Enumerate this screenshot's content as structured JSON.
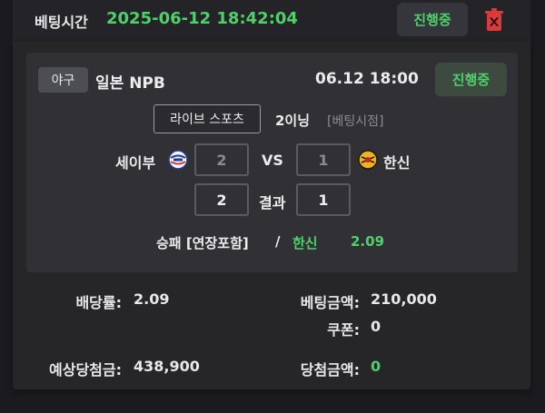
{
  "header": {
    "bet_time_label": "베팅시간",
    "bet_time_value": "2025-06-12 18:42:04",
    "status_label": "진행중"
  },
  "game": {
    "sport": "야구",
    "league": "일본 NPB",
    "time": "06.12 18:00",
    "status_label": "진행중",
    "live_label": "라이브 스포츠",
    "inning": "2이닝",
    "bet_point": "[베팅시점]",
    "home_team": "세이부",
    "away_team": "한신",
    "vs_label": "VS",
    "result_label": "결과",
    "bet_score_home": "2",
    "bet_score_away": "1",
    "result_home": "2",
    "result_away": "1",
    "market": "승패 [연장포함]",
    "slash": "/",
    "pick": "한신",
    "pick_odds": "2.09"
  },
  "summary": {
    "odds_label": "배당률:",
    "odds_value": "2.09",
    "bet_amount_label": "베팅금액:",
    "bet_amount_value": "210,000",
    "coupon_label": "쿠폰:",
    "coupon_value": "0",
    "expected_win_label": "예상당첨금:",
    "expected_win_value": "438,900",
    "win_amount_label": "당첨금액:",
    "win_amount_value": "0"
  },
  "colors": {
    "accent_green": "#4fd16a",
    "delete_red": "#d93a3a"
  },
  "icons": {
    "delete": "trash-icon",
    "home_logo": "lions-logo-icon",
    "away_logo": "tigers-logo-icon"
  }
}
